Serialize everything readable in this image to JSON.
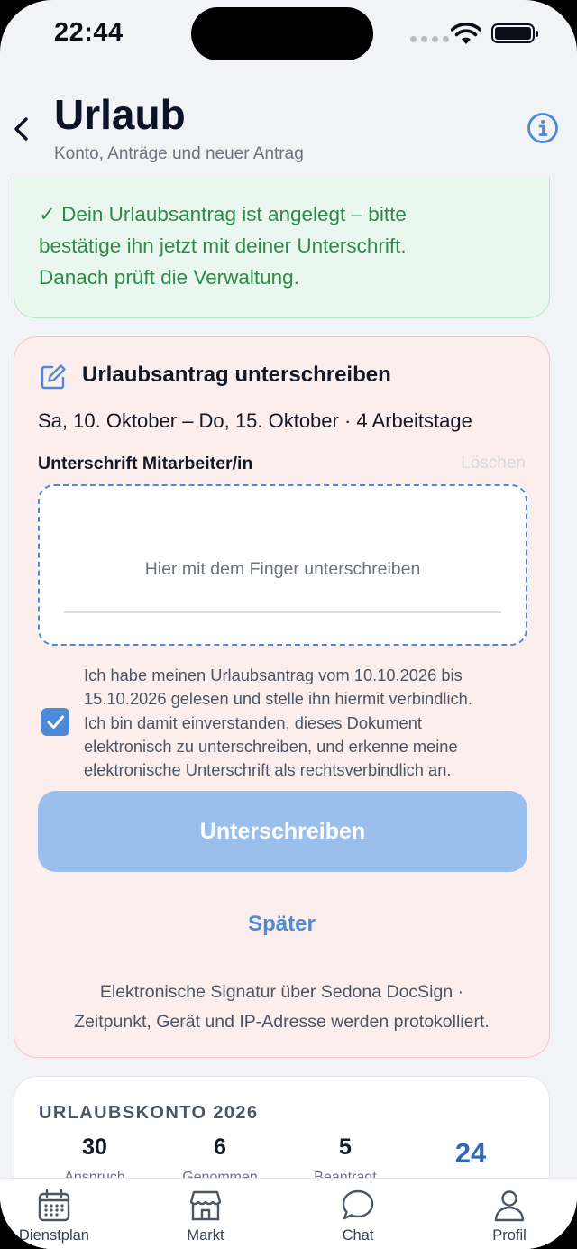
{
  "status_bar": {
    "time": "22:44"
  },
  "header": {
    "title": "Urlaub",
    "subtitle": "Konto, Anträge und neuer Antrag"
  },
  "banner": {
    "line1": "✓ Dein Urlaubsantrag ist angelegt – bitte",
    "line2": "bestätige ihn jetzt mit deiner Unterschrift.",
    "line3": "Danach prüft die Verwaltung."
  },
  "sign_card": {
    "title": "Urlaubsantrag unterschreiben",
    "dates": "Sa, 10. Oktober – Do, 15. Oktober · 4 Arbeitstage",
    "signature_label": "Unterschrift Mitarbeiter/in",
    "clear_label": "Löschen",
    "signature_placeholder": "Hier mit dem Finger unterschreiben",
    "consent_checked": true,
    "consent_lines": [
      "Ich habe meinen Urlaubsantrag vom 10.10.2026 bis",
      "15.10.2026 gelesen und stelle ihn hiermit verbindlich.",
      "Ich bin damit einverstanden, dieses Dokument",
      "elektronisch zu unterschreiben, und erkenne meine",
      "elektronische Unterschrift als rechtsverbindlich an."
    ],
    "submit_label": "Unterschreiben",
    "later_label": "Später",
    "footnote_line1": "Elektronische Signatur über Sedona DocSign ·",
    "footnote_line2": "Zeitpunkt, Gerät und IP-Adresse werden protokolliert."
  },
  "account": {
    "title": "URLAUBSKONTO 2026",
    "stats": [
      {
        "value": "30",
        "label": "Anspruch"
      },
      {
        "value": "6",
        "label": "Genommen"
      },
      {
        "value": "5",
        "label": "Beantragt"
      },
      {
        "value": "24",
        "label": ""
      }
    ]
  },
  "tabbar": {
    "items": [
      {
        "label": "Dienstplan",
        "icon": "calendar-icon"
      },
      {
        "label": "Markt",
        "icon": "store-icon"
      },
      {
        "label": "Chat",
        "icon": "chat-bubble-icon"
      },
      {
        "label": "Profil",
        "icon": "person-icon"
      }
    ]
  },
  "colors": {
    "accent": "#4a8ad8",
    "success_text": "#2f8a4a",
    "success_bg": "#e9f7ee",
    "warning_bg": "#fdeeee",
    "button_disabled": "#9bbfec"
  }
}
